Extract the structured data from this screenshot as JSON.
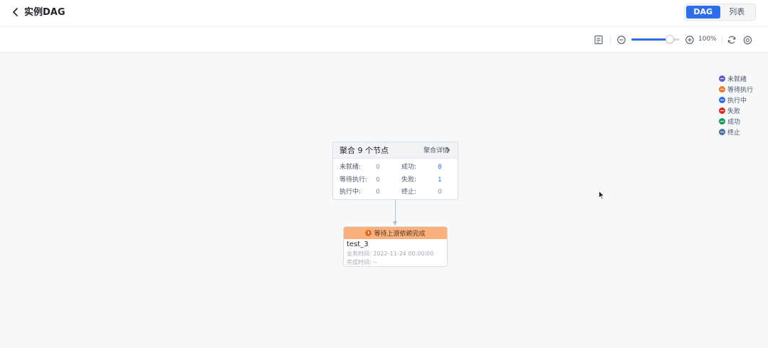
{
  "header": {
    "title": "实例DAG",
    "view_tabs": [
      {
        "label": "DAG",
        "active": true
      },
      {
        "label": "列表",
        "active": false
      }
    ]
  },
  "toolbar": {
    "zoom_percent": "100%",
    "zoom_level": 0.75,
    "icons": [
      "list-icon",
      "zoom-out-icon",
      "zoom-in-icon",
      "refresh-icon",
      "settings-icon"
    ]
  },
  "legend": [
    {
      "label": "未就绪",
      "color": "#5b5fc7"
    },
    {
      "label": "等待执行",
      "color": "#e87b2c"
    },
    {
      "label": "执行中",
      "color": "#2f6ee9"
    },
    {
      "label": "失败",
      "color": "#d93026"
    },
    {
      "label": "成功",
      "color": "#1a9b5d"
    },
    {
      "label": "终止",
      "color": "#4a6fa5"
    }
  ],
  "aggregate": {
    "title": "聚合 9 个节点",
    "detail_link": "聚合详情",
    "stats": [
      {
        "label": "未就绪:",
        "value": "0",
        "highlight": false
      },
      {
        "label": "成功:",
        "value": "8",
        "highlight": true
      },
      {
        "label": "等待执行:",
        "value": "0",
        "highlight": false
      },
      {
        "label": "失败:",
        "value": "1",
        "highlight": true
      },
      {
        "label": "执行中:",
        "value": "0",
        "highlight": false
      },
      {
        "label": "终止:",
        "value": "0",
        "highlight": false
      }
    ]
  },
  "task": {
    "status": "等待上游依赖完成",
    "name": "test_3",
    "business_time_label": "业务时间:",
    "business_time": "2022-11-24 00:00:00",
    "finish_time_label": "完成时间:",
    "finish_time": "--",
    "status_color": "#f9b07c"
  }
}
